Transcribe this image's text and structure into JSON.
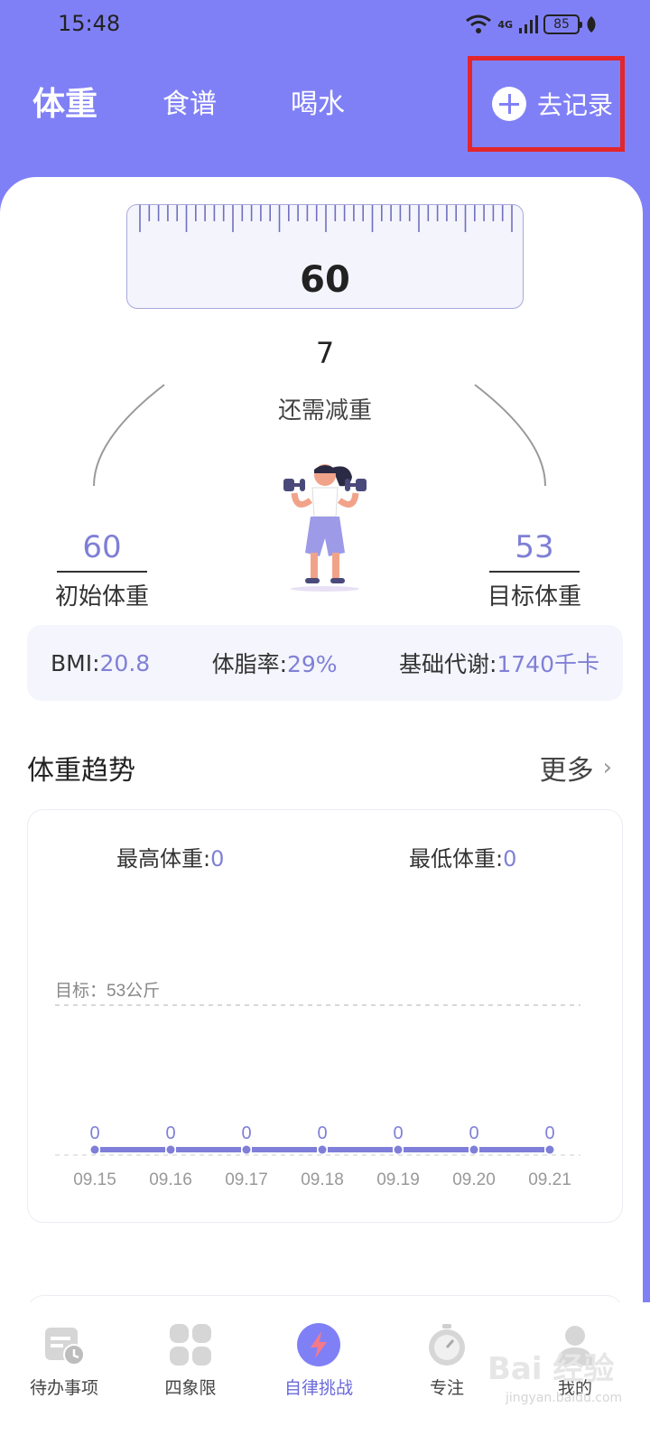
{
  "status_bar": {
    "time": "15:48",
    "network": "4G",
    "battery": "85"
  },
  "header": {
    "tabs": [
      {
        "label": "体重",
        "active": true
      },
      {
        "label": "食谱",
        "active": false
      },
      {
        "label": "喝水",
        "active": false
      }
    ],
    "record_label": "去记录"
  },
  "weight": {
    "current": "60",
    "remaining": "7",
    "remaining_label": "还需减重",
    "initial": "60",
    "initial_label": "初始体重",
    "target": "53",
    "target_label": "目标体重"
  },
  "stats": {
    "bmi_label": "BMI:",
    "bmi_value": "20.8",
    "fat_label": "体脂率:",
    "fat_value": "29%",
    "bmr_label": "基础代谢:",
    "bmr_value": "1740千卡"
  },
  "trend": {
    "title": "体重趋势",
    "more_label": "更多",
    "max_label": "最高体重:",
    "max_value": "0",
    "min_label": "最低体重:",
    "min_value": "0",
    "target_line_label": "目标：53公斤"
  },
  "chart_data": {
    "type": "line",
    "categories": [
      "09.15",
      "09.16",
      "09.17",
      "09.18",
      "09.19",
      "09.20",
      "09.21"
    ],
    "values": [
      0,
      0,
      0,
      0,
      0,
      0,
      0
    ],
    "target": 53,
    "color": "#7f7fd9"
  },
  "nav": [
    {
      "label": "待办事项",
      "icon": "todo-calendar-icon",
      "active": false
    },
    {
      "label": "四象限",
      "icon": "four-quadrant-icon",
      "active": false
    },
    {
      "label": "自律挑战",
      "icon": "lightning-icon",
      "active": true
    },
    {
      "label": "专注",
      "icon": "stopwatch-icon",
      "active": false
    },
    {
      "label": "我的",
      "icon": "user-icon",
      "active": false
    }
  ],
  "watermark": {
    "text": "Bai 经验",
    "sub": "jingyan.baidu.com"
  },
  "colors": {
    "primary": "#8080f6",
    "accent_text": "#7f7fd6",
    "highlight_box": "#e3262a"
  }
}
